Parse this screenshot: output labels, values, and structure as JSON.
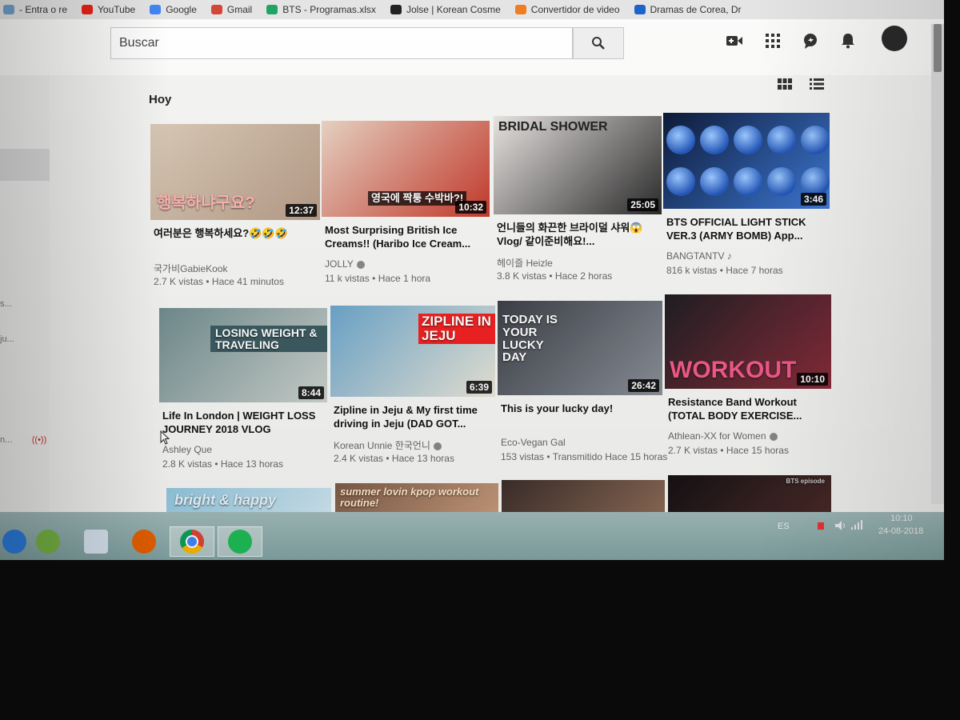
{
  "bookmarks": [
    {
      "label": "- Entra o re",
      "icon": "outlook-icon",
      "color": "#6f9fc8"
    },
    {
      "label": "YouTube",
      "icon": "youtube-icon",
      "color": "#e62117"
    },
    {
      "label": "Google",
      "icon": "google-icon",
      "color": "#4285f4"
    },
    {
      "label": "Gmail",
      "icon": "gmail-icon",
      "color": "#d44638"
    },
    {
      "label": "BTS - Programas.xlsx",
      "icon": "drive-icon",
      "color": "#1fa463"
    },
    {
      "label": "Jolse | Korean Cosme",
      "icon": "jolse-icon",
      "color": "#222222"
    },
    {
      "label": "Convertidor de video",
      "icon": "converter-icon",
      "color": "#ef7d22"
    },
    {
      "label": "Dramas de Corea, Dr",
      "icon": "viki-icon",
      "color": "#1d63c9"
    }
  ],
  "search": {
    "placeholder": "Buscar"
  },
  "header_icons": [
    "video-camera-icon",
    "apps-grid-icon",
    "chat-icon",
    "bell-icon"
  ],
  "section": {
    "title": "Hoy"
  },
  "view_icons": [
    "grid-view-icon",
    "list-view-icon"
  ],
  "videos": [
    {
      "title": "여러분은 행복하세요?🤣🤣🤣",
      "channel": "국가비GabieKook",
      "views": "2.7 K vistas",
      "time": "Hace 41 minutos",
      "duration": "12:37",
      "verified": false,
      "overlay": "행복하냐구요?",
      "colors": [
        "#d8c9b6",
        "#b49a86"
      ]
    },
    {
      "title": "Most Surprising British Ice Creams!! (Haribo Ice Cream...",
      "channel": "JOLLY",
      "views": "11 k vistas",
      "time": "Hace 1 hora",
      "duration": "10:32",
      "verified": true,
      "overlay": "영국에 짝퉁 수박바?!",
      "colors": [
        "#e7d2c2",
        "#c33a2c"
      ]
    },
    {
      "title": "언니들의 화끈한 브라이덜 샤워😱Vlog/ 같이준비해요!...",
      "channel": "헤이즐 Heizle",
      "views": "3.8 K vistas",
      "time": "Hace 2 horas",
      "duration": "25:05",
      "verified": false,
      "overlay": "BRIDAL SHOWER",
      "colors": [
        "#e8e4e2",
        "#2b2b2b"
      ]
    },
    {
      "title": "BTS OFFICIAL LIGHT STICK VER.3 (ARMY BOMB) App...",
      "channel": "BANGTANTV ♪",
      "views": "816 k vistas",
      "time": "Hace 7 horas",
      "duration": "3:46",
      "verified": false,
      "overlay": "",
      "colors": [
        "#0d1a36",
        "#3f7ad8"
      ]
    },
    {
      "title": "Life In London | WEIGHT LOSS JOURNEY 2018 VLOG",
      "channel": "Ashley Que",
      "views": "2.8 K vistas",
      "time": "Hace 13 horas",
      "duration": "8:44",
      "verified": false,
      "overlay": "LOSING WEIGHT & TRAVELING",
      "colors": [
        "#6f8a8c",
        "#c9d0cc"
      ]
    },
    {
      "title": "Zipline in Jeju & My first time driving in Jeju (DAD GOT...",
      "channel": "Korean Unnie 한국언니",
      "views": "2.4 K vistas",
      "time": "Hace 13 horas",
      "duration": "6:39",
      "verified": true,
      "overlay": "ZIPLINE IN JEJU",
      "colors": [
        "#6aa4c9",
        "#e8e4d6"
      ]
    },
    {
      "title": "This is your lucky day!",
      "channel": "Eco-Vegan Gal",
      "views": "153 vistas",
      "time": "Transmitido Hace 15 horas",
      "duration": "26:42",
      "verified": false,
      "overlay": "TODAY IS YOUR LUCKY DAY",
      "colors": [
        "#3c3f46",
        "#8a8f98"
      ]
    },
    {
      "title": "Resistance Band Workout (TOTAL BODY EXERCISE...",
      "channel": "Athlean-XX for Women",
      "views": "2.7 K vistas",
      "time": "Hace 15 horas",
      "duration": "10:10",
      "verified": true,
      "overlay": "WORKOUT",
      "colors": [
        "#1e1e22",
        "#8a2c3b"
      ]
    }
  ],
  "partial_row": [
    {
      "overlay": "bright & happy",
      "colors": [
        "#8fc4dc",
        "#cfe4ee"
      ]
    },
    {
      "overlay": "summer lovin kpop workout routine!",
      "colors": [
        "#7a5a48",
        "#c79a7a"
      ]
    },
    {
      "overlay": "",
      "colors": [
        "#3b2d2a",
        "#8b6a55"
      ]
    },
    {
      "overlay": "BTS episode",
      "colors": [
        "#151114",
        "#4a2a28"
      ]
    }
  ],
  "taskbar": {
    "apps": [
      "ie-icon",
      "utorrent-icon",
      "app-icon",
      "firefox-icon",
      "chrome-icon",
      "spotify-icon"
    ],
    "lang": "ES",
    "time": "10:10",
    "date": "24-08-2018"
  }
}
